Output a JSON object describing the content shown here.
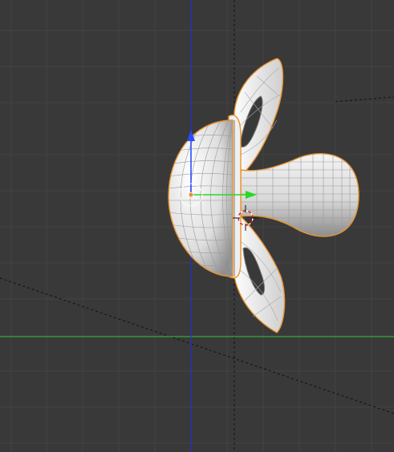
{
  "app": "3D Viewport",
  "colors": {
    "background": "#393939",
    "grid_minor": "#434343",
    "grid_major": "#4a4a4a",
    "axis_x": "#2fae2f",
    "axis_y_vertical": "#2430c8",
    "selection_outline": "#e8932c",
    "mesh_fill": "#e9e9e9",
    "mesh_shadow": "#9d9d9d",
    "wire": "#8c8c8c",
    "gizmo_z": "#2b4bff",
    "gizmo_y": "#28d928",
    "cursor_red": "#d21c1c"
  },
  "object": {
    "type": "mesh",
    "semantic": "pacifier",
    "selected": true
  },
  "gizmo": {
    "mode": "translate",
    "axes": [
      "z",
      "y"
    ]
  },
  "icons": {
    "cursor": "3d-cursor-icon",
    "origin": "object-origin-icon"
  }
}
